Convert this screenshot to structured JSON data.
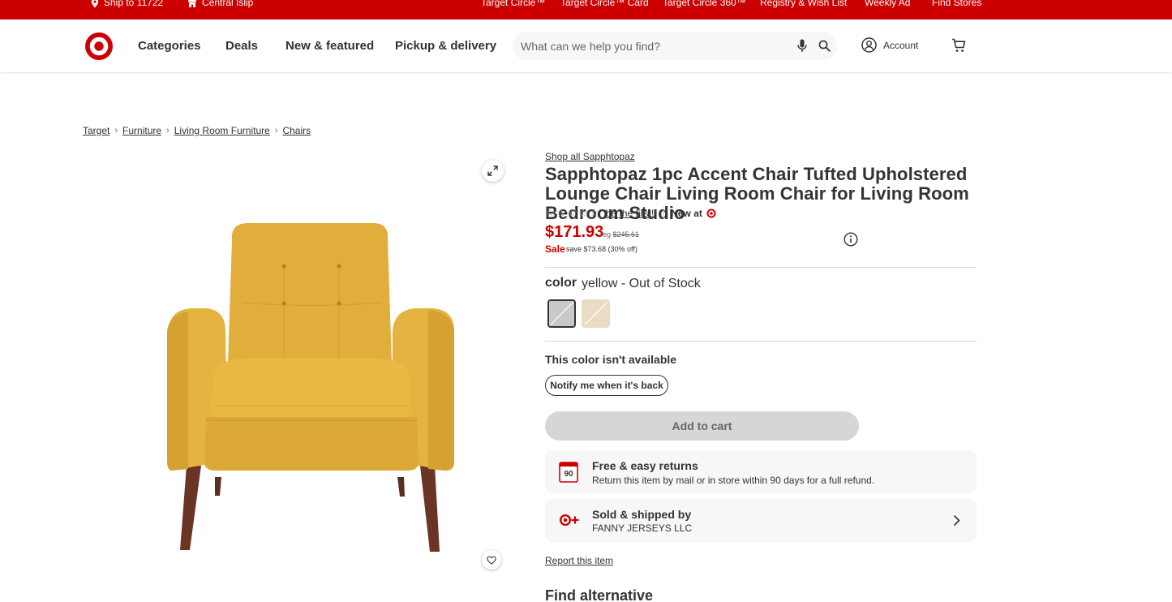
{
  "topbar": {
    "ship_to": "Ship to 11722",
    "store": "Central Islip",
    "links": [
      "Target Circle™",
      "Target Circle™ Card",
      "Target Circle 360™",
      "Registry & Wish List",
      "Weekly Ad",
      "Find Stores"
    ]
  },
  "header": {
    "nav": [
      "Categories",
      "Deals",
      "New & featured",
      "Pickup & delivery"
    ],
    "search_placeholder": "What can we help you find?",
    "account_label": "Account"
  },
  "breadcrumb": [
    "Target",
    "Furniture",
    "Living Room Furniture",
    "Chairs"
  ],
  "product": {
    "shop_all": "Shop all Sapphtopaz",
    "title": "Sapphtopaz 1pc Accent Chair Tufted Upholstered Lounge Chair Living Room Chair for Living Room Bedroom Studio",
    "rating_prompt": "be the first!",
    "rating_value": 0,
    "rating_max": 5,
    "new_at": "New at",
    "price": "$171.93",
    "reg_label": "reg",
    "reg_price": "$245.61",
    "sale_label": "Sale",
    "save_text": "save $73.68 (30% off)",
    "color_label": "color",
    "color_value": "yellow - Out of Stock",
    "swatch_colors": [
      "#c9c9c9",
      "#eadcc3"
    ],
    "unavailable_text": "This color isn't available",
    "notify_label": "Notify me when it's back",
    "add_to_cart": "Add to cart",
    "returns_title": "Free & easy returns",
    "returns_text": "Return this item by mail or in store within 90 days for a full refund.",
    "returns_icon_text": "90",
    "sold_title": "Sold & shipped by",
    "sold_by": "FANNY JERSEYS LLC",
    "report": "Report this item",
    "find_alternative": "Find alternative"
  },
  "colors": {
    "brand_red": "#cc0000",
    "chair_yellow": "#e2b13d"
  }
}
